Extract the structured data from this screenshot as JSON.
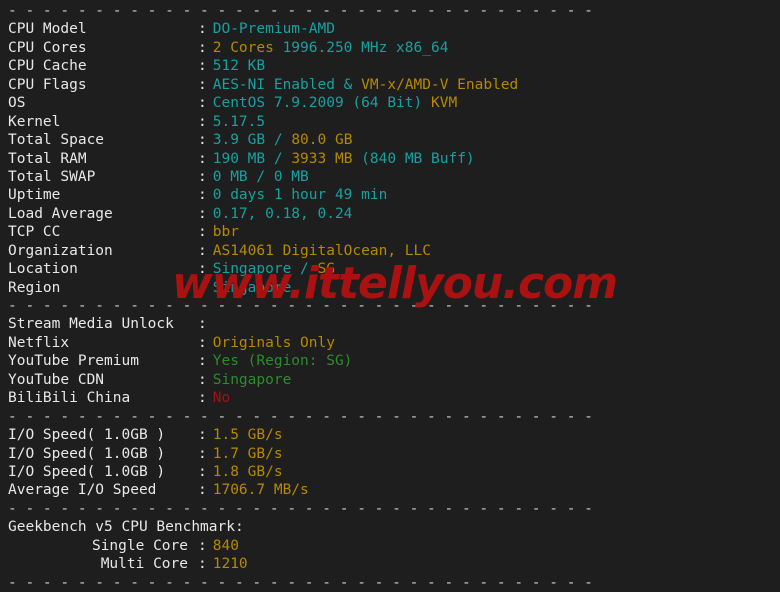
{
  "terminal": {
    "separator_char": "- ",
    "watermark": "www.ittellyou.com",
    "colors": {
      "background": "#1e1e1e",
      "label": "#e8e8e8",
      "cyan": "#18a0a0",
      "yellow": "#b58900",
      "green": "#2e8b2e",
      "red": "#a51111",
      "watermark": "#aa1111"
    }
  },
  "system_info": {
    "rows": [
      {
        "label": "CPU Model",
        "segments": [
          {
            "text": "DO-Premium-AMD",
            "color": "cyan"
          }
        ]
      },
      {
        "label": "CPU Cores",
        "segments": [
          {
            "text": "2 Cores",
            "color": "yellow"
          },
          {
            "text": " 1996.250 MHz x86_64",
            "color": "cyan"
          }
        ]
      },
      {
        "label": "CPU Cache",
        "segments": [
          {
            "text": "512 KB",
            "color": "cyan"
          }
        ]
      },
      {
        "label": "CPU Flags",
        "segments": [
          {
            "text": "AES-NI Enabled",
            "color": "cyan"
          },
          {
            "text": " & ",
            "color": "cyan"
          },
          {
            "text": "VM-x/AMD-V Enabled",
            "color": "yellow"
          }
        ]
      },
      {
        "label": "OS",
        "segments": [
          {
            "text": "CentOS 7.9.2009 (64 Bit) ",
            "color": "cyan"
          },
          {
            "text": "KVM",
            "color": "yellow"
          }
        ]
      },
      {
        "label": "Kernel",
        "segments": [
          {
            "text": "5.17.5",
            "color": "cyan"
          }
        ]
      },
      {
        "label": "Total Space",
        "segments": [
          {
            "text": "3.9 GB",
            "color": "cyan"
          },
          {
            "text": " / ",
            "color": "cyan"
          },
          {
            "text": "80.0 GB",
            "color": "yellow"
          }
        ]
      },
      {
        "label": "Total RAM",
        "segments": [
          {
            "text": "190 MB",
            "color": "cyan"
          },
          {
            "text": " / ",
            "color": "cyan"
          },
          {
            "text": "3933 MB",
            "color": "yellow"
          },
          {
            "text": " (840 MB Buff)",
            "color": "cyan"
          }
        ]
      },
      {
        "label": "Total SWAP",
        "segments": [
          {
            "text": "0 MB / 0 MB",
            "color": "cyan"
          }
        ]
      },
      {
        "label": "Uptime",
        "segments": [
          {
            "text": "0 days 1 hour 49 min",
            "color": "cyan"
          }
        ]
      },
      {
        "label": "Load Average",
        "segments": [
          {
            "text": "0.17, 0.18, 0.24",
            "color": "cyan"
          }
        ]
      },
      {
        "label": "TCP CC",
        "segments": [
          {
            "text": "bbr",
            "color": "yellow"
          }
        ]
      },
      {
        "label": "Organization",
        "segments": [
          {
            "text": "AS14061 DigitalOcean, LLC",
            "color": "yellow"
          }
        ]
      },
      {
        "label": "Location",
        "segments": [
          {
            "text": "Singapore",
            "color": "cyan"
          },
          {
            "text": " / ",
            "color": "cyan"
          },
          {
            "text": "SG",
            "color": "yellow"
          }
        ]
      },
      {
        "label": "Region",
        "segments": [
          {
            "text": "Singapore",
            "color": "cyan"
          }
        ]
      }
    ]
  },
  "stream_media": {
    "rows": [
      {
        "label": "Stream Media Unlock",
        "segments": []
      },
      {
        "label": "Netflix",
        "segments": [
          {
            "text": "Originals Only",
            "color": "yellow"
          }
        ]
      },
      {
        "label": "YouTube Premium",
        "segments": [
          {
            "text": "Yes (Region: SG)",
            "color": "green"
          }
        ]
      },
      {
        "label": "YouTube CDN",
        "segments": [
          {
            "text": "Singapore",
            "color": "green"
          }
        ]
      },
      {
        "label": "BiliBili China",
        "segments": [
          {
            "text": "No",
            "color": "red"
          }
        ]
      }
    ]
  },
  "io_speed": {
    "rows": [
      {
        "label": "I/O Speed( 1.0GB )",
        "segments": [
          {
            "text": "1.5 GB/s",
            "color": "yellow"
          }
        ]
      },
      {
        "label": "I/O Speed( 1.0GB )",
        "segments": [
          {
            "text": "1.7 GB/s",
            "color": "yellow"
          }
        ]
      },
      {
        "label": "I/O Speed( 1.0GB )",
        "segments": [
          {
            "text": "1.8 GB/s",
            "color": "yellow"
          }
        ]
      },
      {
        "label": "Average I/O Speed",
        "segments": [
          {
            "text": "1706.7 MB/s",
            "color": "yellow"
          }
        ]
      }
    ]
  },
  "geekbench": {
    "heading": "Geekbench v5 CPU Benchmark:",
    "rows": [
      {
        "label": "Single Core",
        "segments": [
          {
            "text": "840",
            "color": "yellow"
          }
        ]
      },
      {
        "label": "Multi Core",
        "segments": [
          {
            "text": "1210",
            "color": "yellow"
          }
        ]
      }
    ]
  }
}
